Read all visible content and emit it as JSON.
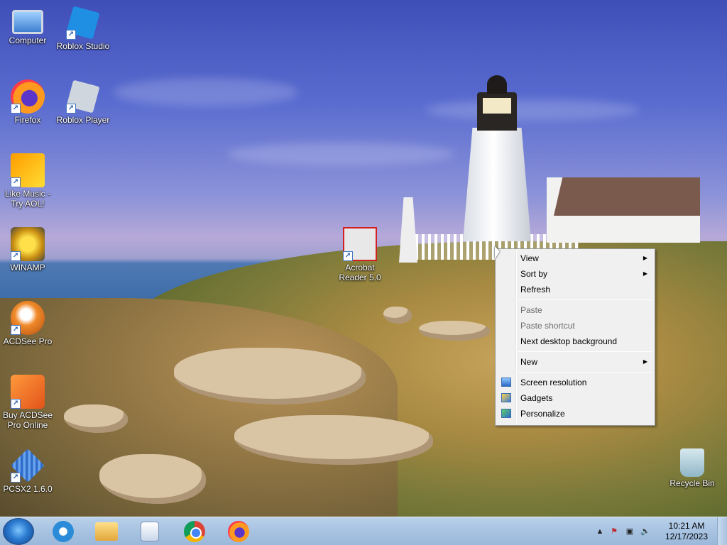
{
  "desktop": {
    "icons": [
      {
        "label": "Computer",
        "icon": "computer-icon"
      },
      {
        "label": "Roblox Studio",
        "icon": "roblox-studio-icon"
      },
      {
        "label": "Firefox",
        "icon": "firefox-icon"
      },
      {
        "label": "Roblox Player",
        "icon": "roblox-player-icon"
      },
      {
        "label": "Like Music - Try AOL!",
        "icon": "music-icon"
      },
      {
        "label": "WINAMP",
        "icon": "winamp-icon"
      },
      {
        "label": "ACDSee Pro",
        "icon": "acdsee-icon"
      },
      {
        "label": "Buy ACDSee Pro Online",
        "icon": "shopping-cart-icon"
      },
      {
        "label": "PCSX2 1.6.0",
        "icon": "pcsx2-icon"
      },
      {
        "label": "Acrobat Reader 5.0",
        "icon": "acrobat-icon"
      },
      {
        "label": "Recycle Bin",
        "icon": "recycle-bin-icon"
      }
    ]
  },
  "context_menu": {
    "view": "View",
    "sort_by": "Sort by",
    "refresh": "Refresh",
    "paste": "Paste",
    "paste_shortcut": "Paste shortcut",
    "next_background": "Next desktop background",
    "new": "New",
    "screen_resolution": "Screen resolution",
    "gadgets": "Gadgets",
    "personalize": "Personalize",
    "submenu_arrow": "▶"
  },
  "taskbar": {
    "pinned": [
      {
        "name": "Internet Explorer",
        "icon": "internet-explorer-icon"
      },
      {
        "name": "Windows Explorer",
        "icon": "folder-icon"
      },
      {
        "name": "Windows Media Player",
        "icon": "media-player-icon"
      },
      {
        "name": "Google Chrome",
        "icon": "chrome-icon"
      },
      {
        "name": "Firefox",
        "icon": "firefox-icon"
      }
    ],
    "tray": {
      "time": "10:21 AM",
      "date": "12/17/2023",
      "show_hidden": "▲"
    }
  },
  "colors": {
    "taskbar": "#a9c4e2",
    "menu_bg": "#f0f0f0",
    "menu_disabled": "#6d6d6d"
  }
}
